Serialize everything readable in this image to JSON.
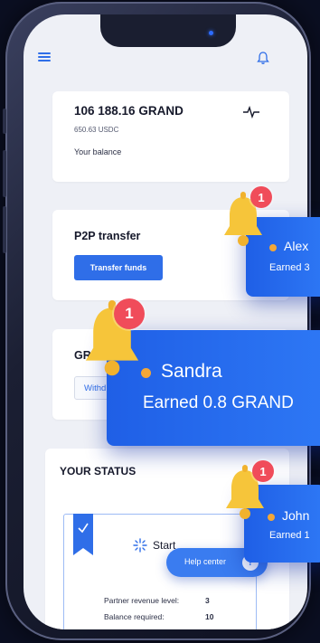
{
  "header": {
    "menu_icon": "hamburger-menu-icon",
    "bell_icon": "bell-icon"
  },
  "balance": {
    "amount": "106 188.16 GRAND",
    "usdc": "650.63 USDC",
    "label": "Your balance",
    "icon": "activity-icon"
  },
  "p2p": {
    "title": "P2P transfer",
    "button_label": "Transfer funds"
  },
  "grand_card": {
    "title": "GRA",
    "button_label": "Withd"
  },
  "status": {
    "title": "YOUR STATUS",
    "level_name": "Start",
    "rows": [
      {
        "label": "Partner revenue level:",
        "value": "3"
      },
      {
        "label": "Balance required:",
        "value": "10"
      }
    ]
  },
  "help": {
    "label": "Help center",
    "icon": "?"
  },
  "notifications": [
    {
      "name": "Alex",
      "earned": "Earned 3",
      "badge": "1"
    },
    {
      "name": "Sandra",
      "earned": "Earned 0.8 GRAND",
      "badge": "1"
    },
    {
      "name": "John",
      "earned": "Earned 1",
      "badge": "1"
    }
  ],
  "colors": {
    "accent": "#2f6ee8",
    "notification": "#2466ee",
    "badge": "#f04c5a",
    "bell": "#f6c53a",
    "dot": "#f3a737"
  }
}
